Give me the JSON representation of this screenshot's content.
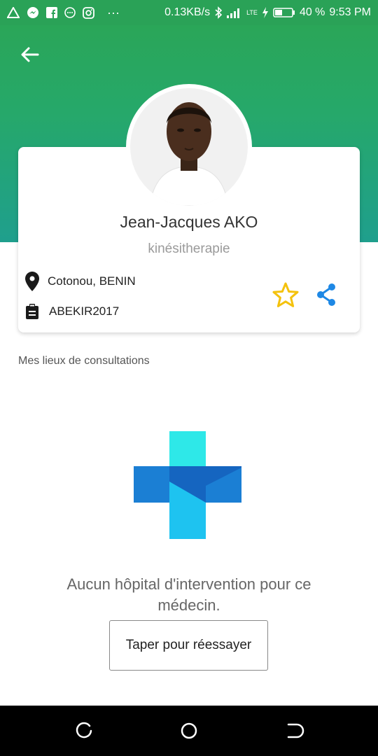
{
  "status_bar": {
    "speed": "0.13KB/s",
    "network": "LTE",
    "battery": "40 %",
    "time": "9:53 PM",
    "notification_icons": [
      "alert-triangle-icon",
      "messenger-icon",
      "facebook-icon",
      "chat-icon",
      "instagram-icon",
      "more-dots-icon"
    ],
    "dots": "···"
  },
  "colors": {
    "header_green": "#2aa257",
    "teal": "#1f9f8d",
    "star": "#f4c20d",
    "share": "#1e88e5"
  },
  "doctor": {
    "name": "Jean-Jacques  AKO",
    "specialty": "kinésitherapie",
    "location": "Cotonou, BENIN",
    "code": "ABEKIR2017"
  },
  "section": {
    "label": "Mes lieux de consultations"
  },
  "empty_state": {
    "message": "Aucun hôpital d'intervention pour ce médecin.",
    "retry_label": "Taper pour réessayer"
  }
}
